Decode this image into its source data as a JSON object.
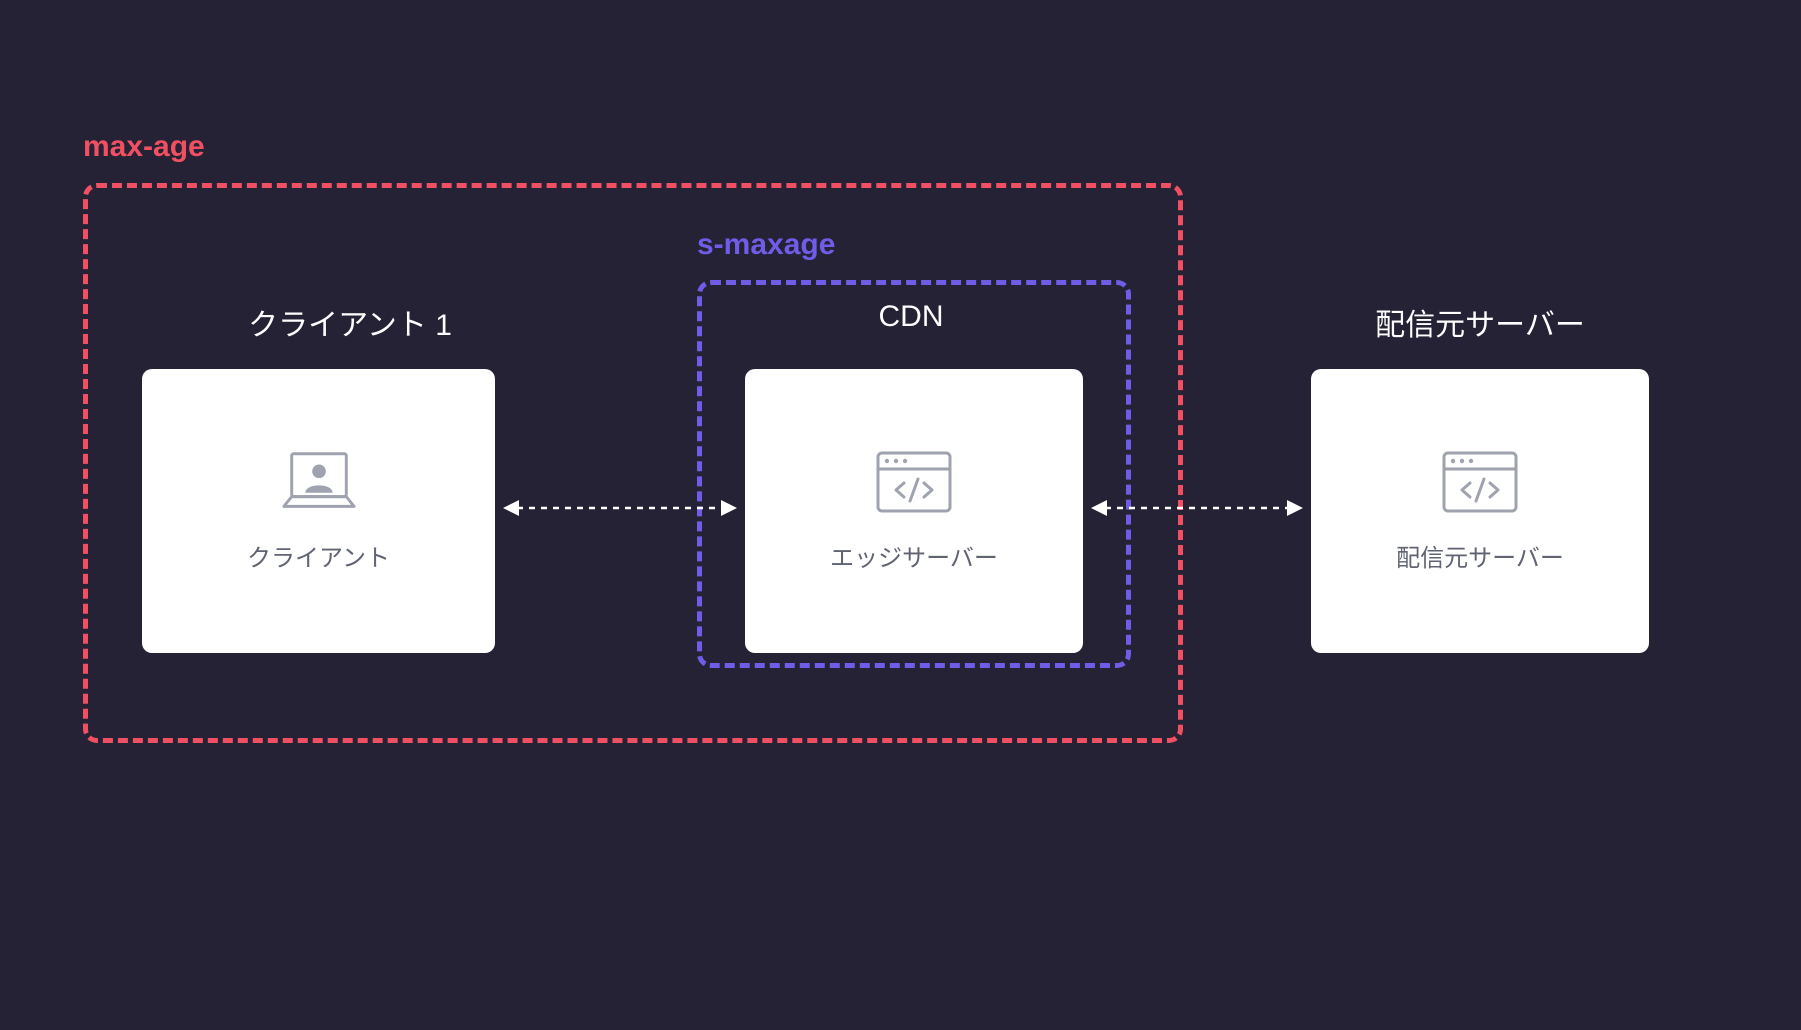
{
  "diagram": {
    "outer_region_label": "max-age",
    "inner_region_label": "s-maxage",
    "client_section_title": "クライアント 1",
    "cdn_section_title": "CDN",
    "origin_section_title": "配信元サーバー",
    "client_card_caption": "クライアント",
    "edge_card_caption": "エッジサーバー",
    "origin_card_caption": "配信元サーバー",
    "colors": {
      "bg": "#242234",
      "max_age": "#F15063",
      "s_maxage": "#6F5DE8",
      "card_bg": "#ffffff",
      "icon_stroke": "#9FA3AF",
      "caption": "#606371",
      "arrow": "#ffffff"
    },
    "concept": "max-age scope covers client cache and CDN edge cache; s-maxage scope covers CDN edge cache only. Bidirectional flows: client ⇄ edge server ⇄ origin server."
  }
}
